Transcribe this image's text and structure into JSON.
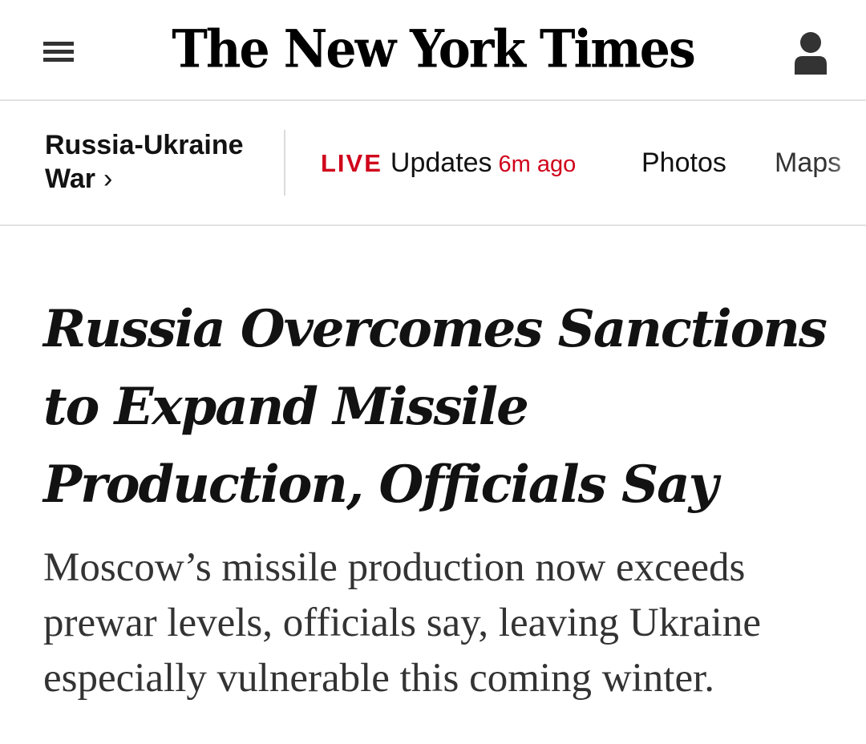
{
  "masthead": {
    "logo_text": "The New York Times",
    "menu_icon": "hamburger-menu-icon",
    "account_icon": "user-account-icon"
  },
  "section_nav": {
    "section_label": "Russia-Ukraine War",
    "section_chevron": "›",
    "live_tag": "LIVE",
    "live_label": "Updates",
    "live_time": "6m ago",
    "items": [
      {
        "label": "Photos"
      },
      {
        "label": "Maps"
      }
    ]
  },
  "article": {
    "headline": "Russia Overcomes Sanctions to Expand Missile Production, Officials Say",
    "summary": "Moscow’s missile production now exceeds prewar levels, officials say, leaving Ukraine especially vulnerable this coming winter."
  },
  "colors": {
    "live_red": "#d0021b",
    "text": "#121212",
    "summary_text": "#333333",
    "divider": "#e2e2e2"
  }
}
